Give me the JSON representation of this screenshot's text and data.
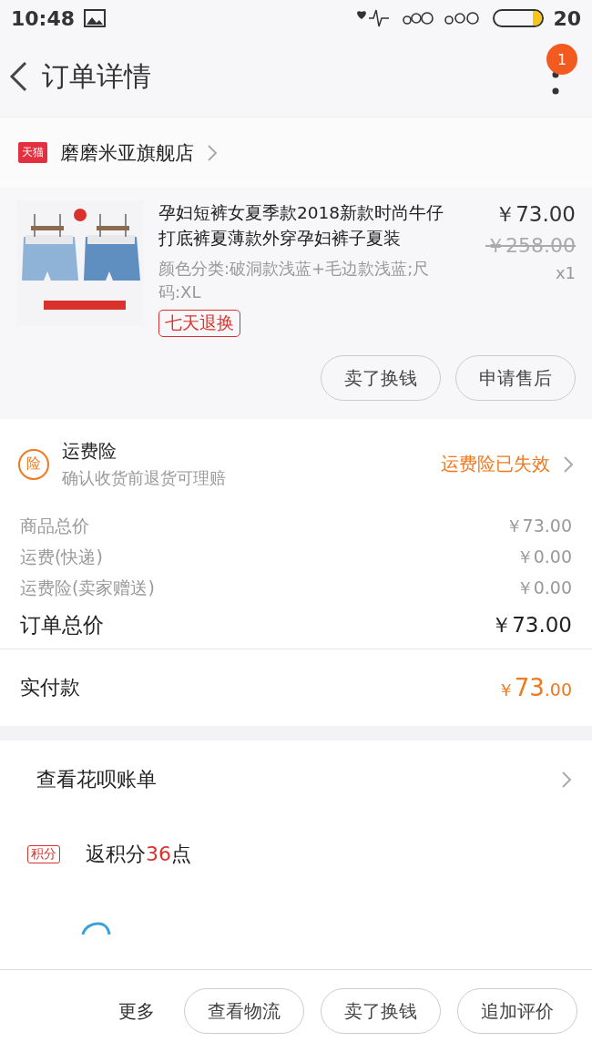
{
  "status_bar": {
    "time": "10:48",
    "battery_text": "20",
    "battery": {
      "level": 0.2
    }
  },
  "header": {
    "title": "订单详情",
    "badge": "1"
  },
  "store": {
    "badge": "天猫",
    "name": "磨磨米亚旗舰店"
  },
  "product": {
    "image": {
      "kind": "picture"
    },
    "title": "孕妇短裤女夏季款2018新款时尚牛仔打底裤夏薄款外穿孕妇裤子夏装",
    "spec": "颜色分类:破洞款浅蓝+毛边款浅蓝;尺码:XL",
    "tag": "七天退换",
    "price": "￥73.00",
    "original_price": "￥258.00",
    "quantity": "x1",
    "buttons": [
      "卖了换钱",
      "申请售后"
    ]
  },
  "insurance": {
    "icon": "险",
    "title": "运费险",
    "subtitle": "确认收货前退货可理赔",
    "status": "运费险已失效"
  },
  "costs": [
    {
      "label": "商品总价",
      "value": "￥73.00",
      "kind": "minor"
    },
    {
      "label": "运费(快递)",
      "value": "￥0.00",
      "kind": "minor"
    },
    {
      "label": "运费险(卖家赠送)",
      "value": "￥0.00",
      "kind": "minor"
    },
    {
      "label": "订单总价",
      "value": "￥73.00",
      "kind": "total"
    }
  ],
  "paid": {
    "label": "实付款",
    "currency": "￥",
    "amount": "73",
    "decimals": ".00"
  },
  "huabei": {
    "label": "查看花呗账单"
  },
  "points": {
    "badge": "积分",
    "prefix": "返积分",
    "amount": "36",
    "suffix": "点"
  },
  "bottom_bar": {
    "more": "更多",
    "buttons": [
      "查看物流",
      "卖了换钱",
      "追加评价"
    ]
  }
}
